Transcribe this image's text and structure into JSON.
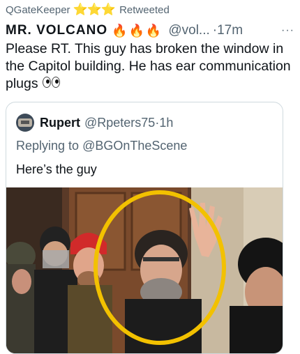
{
  "retweet": {
    "user": "QGateKeeper",
    "star_emoji": "⭐⭐⭐",
    "label": "Retweeted"
  },
  "tweet": {
    "name": "MR. VOLCANO",
    "name_emoji": "🔥🔥🔥",
    "handle": "@vol...",
    "time": "·17m",
    "more": "···",
    "text": "Please RT. This guy has broken the window in the Capitol building. He has ear communication plugs"
  },
  "quoted": {
    "name": "Rupert",
    "handle": "@Rpeters75",
    "time": "·1h",
    "replying_prefix": "Replying to",
    "replying_handle": "@BGOnTheScene",
    "text": "Here’s the guy"
  },
  "colors": {
    "secondary_text": "#536471",
    "highlight_circle": "#f2c100",
    "border": "#cfd9de"
  },
  "icons": {
    "eyes": "eyes-emoji-icon",
    "more": "more-options-icon",
    "avatar": "avatar-image"
  }
}
